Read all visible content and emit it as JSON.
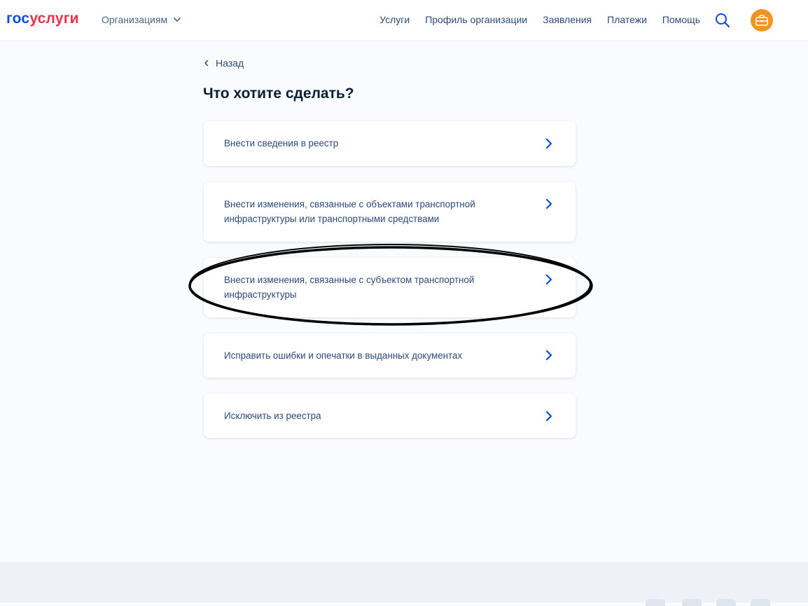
{
  "header": {
    "logo_part1": "гос",
    "logo_part2": "услуги",
    "org_menu_label": "Организациям",
    "nav": [
      {
        "label": "Услуги"
      },
      {
        "label": "Профиль организации"
      },
      {
        "label": "Заявления"
      },
      {
        "label": "Платежи"
      },
      {
        "label": "Помощь"
      }
    ],
    "search_icon": "search-icon",
    "avatar_icon": "briefcase-icon",
    "avatar_color": "#f39322"
  },
  "back_label": "Назад",
  "page_title": "Что хотите сделать?",
  "options": [
    {
      "label": "Внести сведения в реестр"
    },
    {
      "label": "Внести изменения, связанные с объектами транспортной инфраструктуры или транспортными средствами"
    },
    {
      "label": "Внести изменения, связанные с субъектом транспортной инфраструктуры"
    },
    {
      "label": "Исправить ошибки и опечатки в выданных документах"
    },
    {
      "label": "Исключить из реестра"
    }
  ],
  "colors": {
    "logo_blue": "#0d4cd3",
    "logo_red": "#e3324a",
    "link": "#2c4a7a",
    "chevron": "#0d4cd3",
    "background": "#f9fbfe",
    "annotation_ellipse": "#000000"
  }
}
